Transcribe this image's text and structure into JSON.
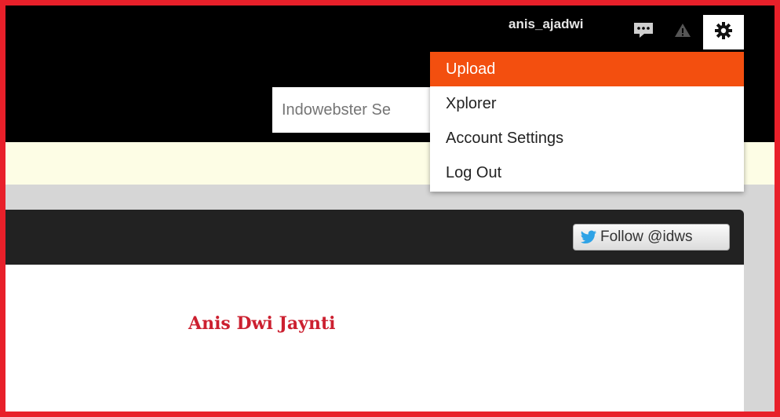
{
  "header": {
    "username": "anis_ajadwi",
    "icons": [
      "chat-icon",
      "alert-icon",
      "gear-icon"
    ]
  },
  "search": {
    "placeholder": "Indowebster Se"
  },
  "dropdown": {
    "items": [
      {
        "label": "Upload",
        "active": true
      },
      {
        "label": "Xplorer"
      },
      {
        "label": "Account Settings"
      },
      {
        "label": "Log Out"
      }
    ],
    "active_color": "#f34f0f"
  },
  "social": {
    "follow_label": "Follow @idws"
  },
  "profile": {
    "name": "Anis Dwi Jaynti"
  },
  "colors": {
    "frame": "#e8202a",
    "topbar": "#000000",
    "notice": "#fdfde5",
    "name": "#cc2030"
  }
}
